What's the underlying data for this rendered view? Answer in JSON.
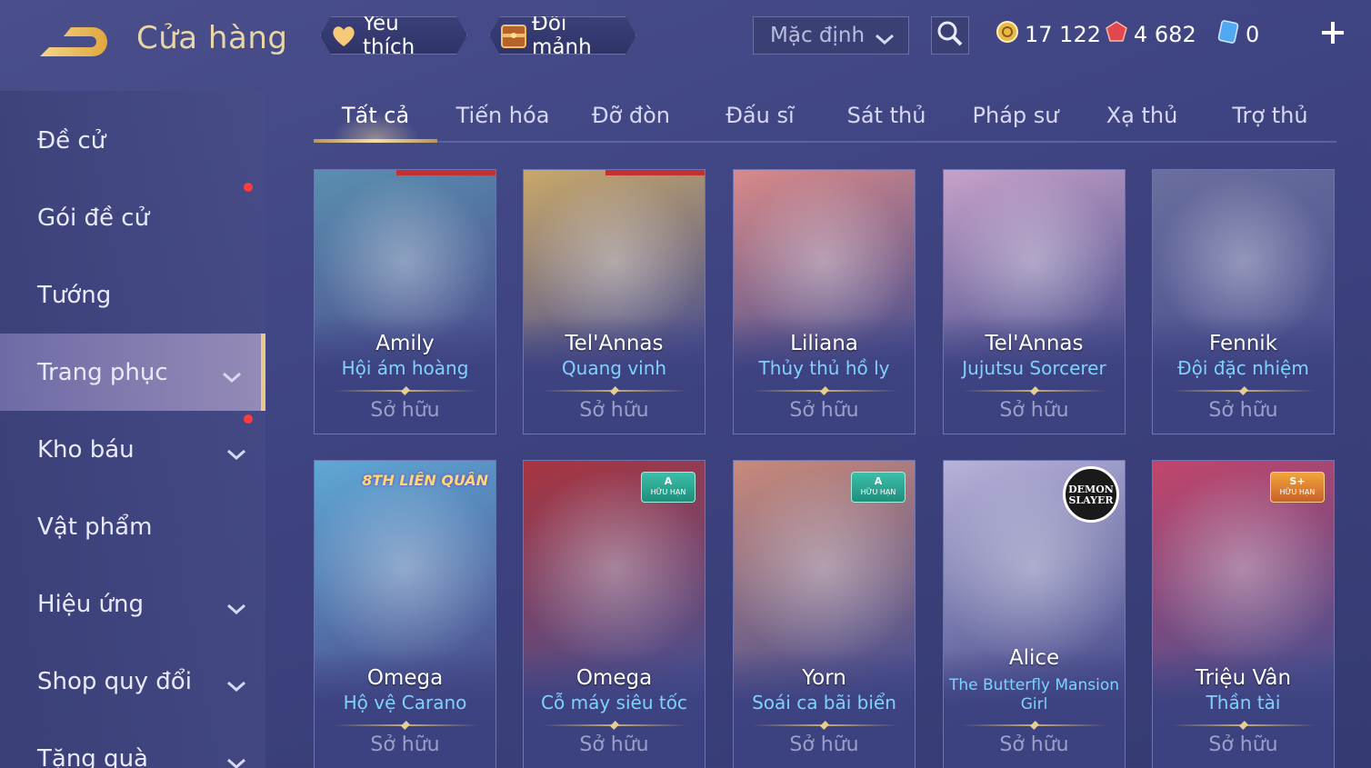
{
  "header": {
    "title": "Cửa hàng",
    "favorite_label": "Yêu thích",
    "exchange_label": "Đổi mảnh",
    "sort_value": "Mặc định",
    "currencies": {
      "gold": "17 122",
      "ruby": "4 682",
      "voucher": "0"
    }
  },
  "sidebar": {
    "items": [
      {
        "label": "Đề cử",
        "dot": false,
        "chevron": false,
        "active": false
      },
      {
        "label": "Gói đề cử",
        "dot": true,
        "chevron": false,
        "active": false
      },
      {
        "label": "Tướng",
        "dot": false,
        "chevron": false,
        "active": false
      },
      {
        "label": "Trang phục",
        "dot": false,
        "chevron": true,
        "active": true
      },
      {
        "label": "Kho báu",
        "dot": true,
        "chevron": true,
        "active": false
      },
      {
        "label": "Vật phẩm",
        "dot": false,
        "chevron": false,
        "active": false
      },
      {
        "label": "Hiệu ứng",
        "dot": false,
        "chevron": true,
        "active": false
      },
      {
        "label": "Shop quy đổi",
        "dot": false,
        "chevron": true,
        "active": false
      },
      {
        "label": "Tặng quà",
        "dot": false,
        "chevron": true,
        "active": false
      }
    ]
  },
  "tabs": [
    {
      "label": "Tất cả",
      "active": true
    },
    {
      "label": "Tiến hóa",
      "active": false
    },
    {
      "label": "Đỡ đòn",
      "active": false
    },
    {
      "label": "Đấu sĩ",
      "active": false
    },
    {
      "label": "Sát thủ",
      "active": false
    },
    {
      "label": "Pháp sư",
      "active": false
    },
    {
      "label": "Xạ thủ",
      "active": false
    },
    {
      "label": "Trợ thủ",
      "active": false
    }
  ],
  "cards": [
    {
      "hero": "Amily",
      "skin": "Hội ám hoàng",
      "status": "Sở hữu",
      "theme": "#5a8fb0"
    },
    {
      "hero": "Tel'Annas",
      "skin": "Quang vinh",
      "status": "Sở hữu",
      "theme": "#c9a86a"
    },
    {
      "hero": "Liliana",
      "skin": "Thủy thủ hồ ly",
      "status": "Sở hữu",
      "theme": "#d98a8a"
    },
    {
      "hero": "Tel'Annas",
      "skin": "Jujutsu Sorcerer",
      "status": "Sở hữu",
      "theme": "#c7a2c9"
    },
    {
      "hero": "Fennik",
      "skin": "Đội đặc nhiệm",
      "status": "Sở hữu",
      "theme": "#6a6f9e"
    },
    {
      "hero": "Omega",
      "skin": "Hộ vệ Carano",
      "status": "Sở hữu",
      "theme": "#5fa8d6",
      "tag": "8TH LIÊN QUÂN"
    },
    {
      "hero": "Omega",
      "skin": "Cỗ máy siêu tốc",
      "status": "Sở hữu",
      "theme": "#a9353f",
      "badge": {
        "grade": "A",
        "sub": "HỮU HẠN"
      }
    },
    {
      "hero": "Yorn",
      "skin": "Soái ca bãi biển",
      "status": "Sở hữu",
      "theme": "#c98a7a",
      "badge": {
        "grade": "A",
        "sub": "HỮU HẠN"
      }
    },
    {
      "hero": "Alice",
      "skin": "The Butterfly Mansion Girl",
      "status": "Sở hữu",
      "theme": "#b7b3d9",
      "tag": "DEMON SLAYER"
    },
    {
      "hero": "Triệu Vân",
      "skin": "Thần tài",
      "status": "Sở hữu",
      "theme": "#c2456b",
      "badge": {
        "grade": "S+",
        "sub": "HỮU HẠN"
      }
    }
  ]
}
